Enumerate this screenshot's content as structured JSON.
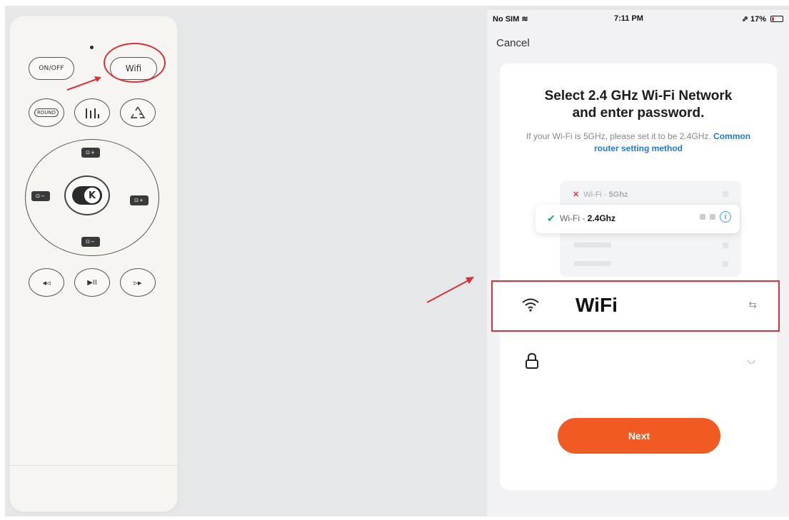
{
  "remote": {
    "buttons": {
      "on_off": "ON/OFF",
      "wifi": "Wifi",
      "mode": "ROUND",
      "levels": "|||.",
      "dpad_up": "⊡+",
      "dpad_down": "⊡−",
      "dpad_left": "⊡−",
      "dpad_right": "⊡+",
      "center": "K",
      "prev": "◂◃",
      "play_pause": "▶II",
      "next": "▹▸"
    }
  },
  "phone": {
    "status": {
      "carrier": "No SIM",
      "time": "7:11 PM",
      "battery": "17%",
      "battery_level": 0.17
    },
    "cancel": "Cancel",
    "title_line1": "Select 2.4 GHz Wi-Fi Network",
    "title_line2": "and enter password.",
    "subtitle_text": "If your Wi-Fi is 5GHz, please set it to be 2.4GHz.",
    "subtitle_link": "Common router setting method",
    "illustration": {
      "bad_network_prefix": "Wi-Fi - ",
      "bad_network_band": "5Ghz",
      "good_network_prefix": "Wi-Fi - ",
      "good_network_band": "2.4Ghz"
    },
    "wifi_field_value": "WiFi",
    "next_button": "Next"
  },
  "colors": {
    "accent": "#f15a22",
    "highlight": "#d7323a",
    "link": "#1f7be0"
  }
}
